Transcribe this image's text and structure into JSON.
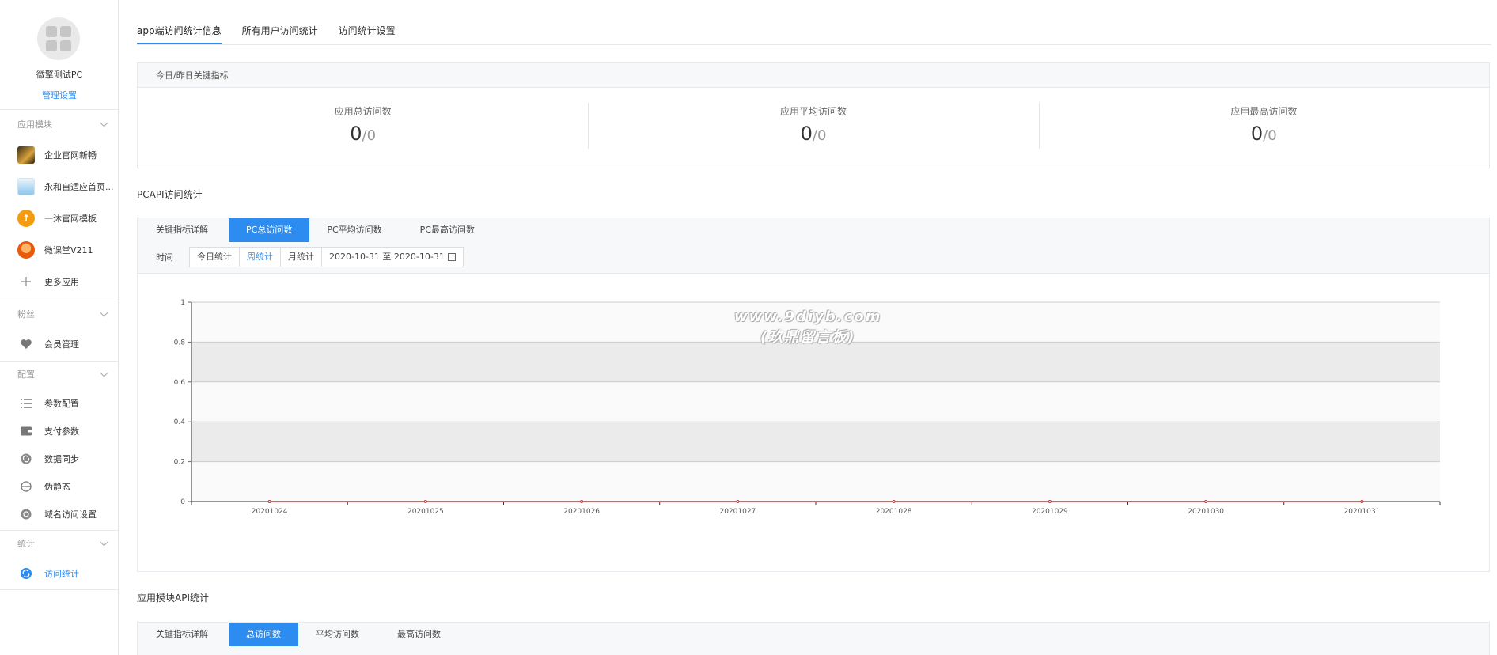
{
  "sidebar": {
    "app_name": "微擎测试PC",
    "manage_label": "管理设置",
    "groups": [
      {
        "label": "应用模块"
      },
      {
        "label": "粉丝"
      },
      {
        "label": "配置"
      },
      {
        "label": "统计"
      }
    ],
    "app_items": [
      {
        "label": "企业官网新畅"
      },
      {
        "label": "永和自适应首页..."
      },
      {
        "label": "一沐官网模板"
      },
      {
        "label": "微课堂V211"
      },
      {
        "label": "更多应用"
      }
    ],
    "fans_items": [
      {
        "label": "会员管理"
      }
    ],
    "config_items": [
      {
        "label": "参数配置"
      },
      {
        "label": "支付参数"
      },
      {
        "label": "数据同步"
      },
      {
        "label": "伪静态"
      },
      {
        "label": "域名访问设置"
      }
    ],
    "stats_items": [
      {
        "label": "访问统计"
      }
    ]
  },
  "top_tabs": [
    {
      "label": "app端访问统计信息"
    },
    {
      "label": "所有用户访问统计"
    },
    {
      "label": "访问统计设置"
    }
  ],
  "kpi_panel": {
    "title": "今日/昨日关键指标",
    "items": [
      {
        "title": "应用总访问数",
        "today": "0",
        "sep": "/",
        "yesterday": "0"
      },
      {
        "title": "应用平均访问数",
        "today": "0",
        "sep": "/",
        "yesterday": "0"
      },
      {
        "title": "应用最高访问数",
        "today": "0",
        "sep": "/",
        "yesterday": "0"
      }
    ]
  },
  "pc_section": {
    "title": "PCAPI访问统计",
    "tabs": [
      {
        "label": "关键指标详解"
      },
      {
        "label": "PC总访问数"
      },
      {
        "label": "PC平均访问数"
      },
      {
        "label": "PC最高访问数"
      }
    ],
    "time_label": "时间",
    "time_options": [
      {
        "label": "今日统计"
      },
      {
        "label": "周统计"
      },
      {
        "label": "月统计"
      }
    ],
    "date_range": "2020-10-31 至 2020-10-31"
  },
  "module_section": {
    "title": "应用模块API统计",
    "tabs": [
      {
        "label": "关键指标详解"
      },
      {
        "label": "总访问数"
      },
      {
        "label": "平均访问数"
      },
      {
        "label": "最高访问数"
      }
    ]
  },
  "watermark": {
    "line1": "www.9diyb.com",
    "line2": "(玖鼎留言板)"
  },
  "colors": {
    "accent": "#2d8cf0",
    "series": "#c23531",
    "band": "#ebebeb"
  },
  "chart_data": {
    "type": "line",
    "x": [
      "20201024",
      "20201025",
      "20201026",
      "20201027",
      "20201028",
      "20201029",
      "20201030",
      "20201031"
    ],
    "series": [
      {
        "values": [
          0,
          0,
          0,
          0,
          0,
          0,
          0,
          0
        ]
      }
    ],
    "ylim": [
      0,
      1
    ],
    "yticks": [
      "0",
      "0.2",
      "0.4",
      "0.6",
      "0.8",
      "1"
    ],
    "grid": "alternating-bands"
  }
}
